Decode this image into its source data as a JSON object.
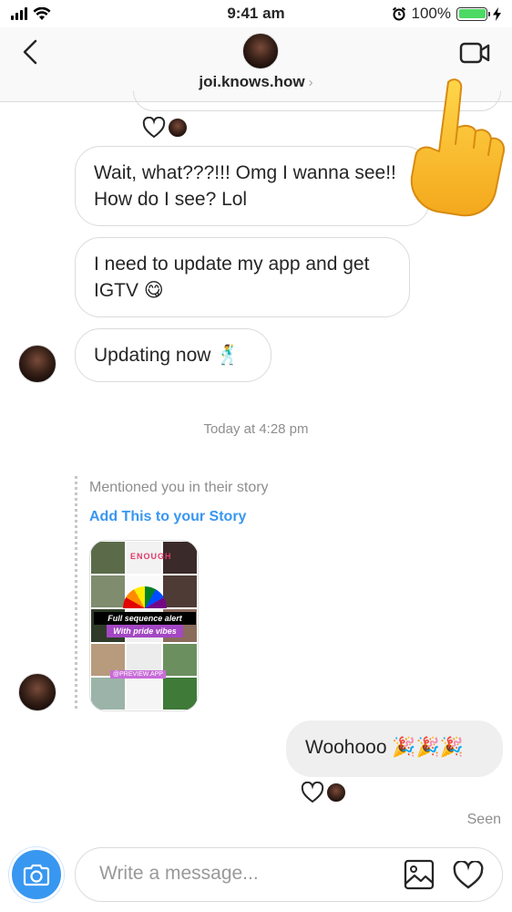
{
  "status_bar": {
    "time": "9:41 am",
    "battery": "100%",
    "battery_fill": 1.0
  },
  "header": {
    "username": "joi.knows.how",
    "chevron": "›"
  },
  "messages": [
    {
      "text": "Wait, what???!!! Omg I wanna see!! How do I see? Lol"
    },
    {
      "text": "I need to update my app and get IGTV"
    },
    {
      "text": "Updating now"
    }
  ],
  "timestamp": "Today at 4:28 pm",
  "story": {
    "mention_text": "Mentioned you in their story",
    "add_link": "Add This to your Story",
    "label_line1": "Full sequence alert",
    "label_line2": "With pride vibes",
    "tag": "@PREVIEW.APP",
    "headline": "ENOUGH"
  },
  "my_message": {
    "text": "Woohooo"
  },
  "seen": "Seen",
  "composer": {
    "placeholder": "Write a message..."
  },
  "icons": {
    "back": "chevron-left-icon",
    "video": "video-camera-icon",
    "camera": "camera-icon",
    "gallery": "image-icon",
    "heart": "heart-icon",
    "pointer": "pointing-hand-icon"
  },
  "colors": {
    "accent": "#3897f0",
    "battery": "#4cd964"
  }
}
